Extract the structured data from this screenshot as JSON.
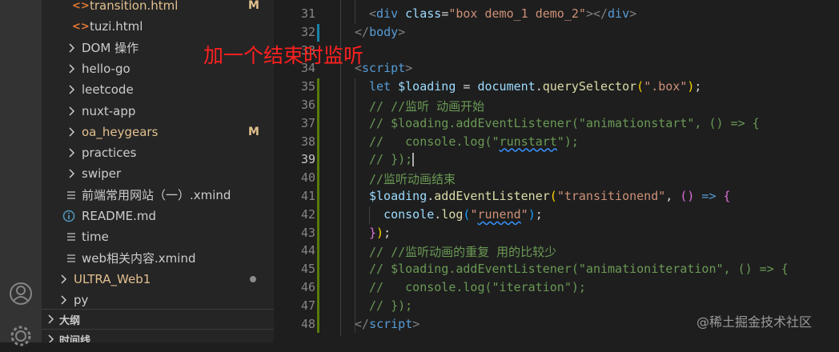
{
  "explorer": {
    "rows": [
      {
        "label": "transition.html",
        "type": "html",
        "badge": "M",
        "color": "#e2c08d"
      },
      {
        "label": "tuzi.html",
        "type": "html",
        "badge": "",
        "color": "#cccccc"
      },
      {
        "label": "DOM 操作",
        "type": "folder",
        "badge": "",
        "color": "#cccccc"
      },
      {
        "label": "hello-go",
        "type": "folder",
        "badge": "",
        "color": "#cccccc"
      },
      {
        "label": "leetcode",
        "type": "folder",
        "badge": "",
        "color": "#cccccc"
      },
      {
        "label": "nuxt-app",
        "type": "folder",
        "badge": "",
        "color": "#cccccc"
      },
      {
        "label": "oa_heygears",
        "type": "folder",
        "badge": "M",
        "color": "#e2c08d"
      },
      {
        "label": "practices",
        "type": "folder",
        "badge": "",
        "color": "#cccccc"
      },
      {
        "label": "swiper",
        "type": "folder",
        "badge": "",
        "color": "#cccccc"
      },
      {
        "label": "前端常用网站（一）.xmind",
        "type": "file",
        "badge": "",
        "color": "#cccccc"
      },
      {
        "label": "README.md",
        "type": "info",
        "badge": "",
        "color": "#cccccc"
      },
      {
        "label": "time",
        "type": "file",
        "badge": "",
        "color": "#cccccc"
      },
      {
        "label": "web相关内容.xmind",
        "type": "file",
        "badge": "",
        "color": "#cccccc"
      },
      {
        "label": "ULTRA_Web1",
        "type": "rootfolder",
        "badge": "dot",
        "color": "#e2c08d"
      },
      {
        "label": "py",
        "type": "rootfolder",
        "badge": "",
        "color": "#cccccc"
      }
    ],
    "sections": [
      {
        "label": "大纲"
      },
      {
        "label": "时间线"
      }
    ]
  },
  "editor": {
    "current_line": "39",
    "lines": [
      {
        "n": "31",
        "tokens": [
          {
            "t": "<",
            "c": "#808080"
          },
          {
            "t": "div",
            "c": "#569cd6"
          },
          {
            "t": " ",
            "c": "#d4d4d4"
          },
          {
            "t": "class",
            "c": "#9cdcfe"
          },
          {
            "t": "=",
            "c": "#d4d4d4"
          },
          {
            "t": "\"box demo_1 demo_2\"",
            "c": "#ce9178"
          },
          {
            "t": "></",
            "c": "#808080"
          },
          {
            "t": "div",
            "c": "#569cd6"
          },
          {
            "t": ">",
            "c": "#808080"
          }
        ]
      },
      {
        "n": "32",
        "tokens": [
          {
            "t": "</",
            "c": "#808080"
          },
          {
            "t": "body",
            "c": "#569cd6"
          },
          {
            "t": ">",
            "c": "#808080"
          }
        ]
      },
      {
        "n": "33",
        "tokens": []
      },
      {
        "n": "34",
        "tokens": [
          {
            "t": "<",
            "c": "#808080"
          },
          {
            "t": "script",
            "c": "#569cd6"
          },
          {
            "t": ">",
            "c": "#808080"
          }
        ]
      },
      {
        "n": "35",
        "tokens": [
          {
            "t": "let ",
            "c": "#569cd6"
          },
          {
            "t": "$loading",
            "c": "#9cdcfe"
          },
          {
            "t": " = ",
            "c": "#d4d4d4"
          },
          {
            "t": "document",
            "c": "#9cdcfe"
          },
          {
            "t": ".",
            "c": "#d4d4d4"
          },
          {
            "t": "querySelector",
            "c": "#dcdcaa"
          },
          {
            "t": "(",
            "c": "#ffd700"
          },
          {
            "t": "\".box\"",
            "c": "#ce9178"
          },
          {
            "t": ")",
            "c": "#ffd700"
          },
          {
            "t": ";",
            "c": "#d4d4d4"
          }
        ]
      },
      {
        "n": "36",
        "tokens": [
          {
            "t": "// //监听 动画开始",
            "c": "#6a9955"
          }
        ]
      },
      {
        "n": "37",
        "tokens": [
          {
            "t": "// $loading.addEventListener(\"animationstart\", () => {",
            "c": "#6a9955"
          }
        ]
      },
      {
        "n": "38",
        "tokens": [
          {
            "t": "//   console.log(\"",
            "c": "#6a9955"
          },
          {
            "t": "runstart",
            "c": "#6a9955",
            "sq": true
          },
          {
            "t": "\");",
            "c": "#6a9955"
          }
        ]
      },
      {
        "n": "39",
        "tokens": [
          {
            "t": "// });",
            "c": "#6a9955"
          }
        ]
      },
      {
        "n": "40",
        "tokens": [
          {
            "t": "//监听动画结束",
            "c": "#6a9955"
          }
        ]
      },
      {
        "n": "41",
        "tokens": [
          {
            "t": "$loading",
            "c": "#9cdcfe"
          },
          {
            "t": ".",
            "c": "#d4d4d4"
          },
          {
            "t": "addEventListener",
            "c": "#dcdcaa"
          },
          {
            "t": "(",
            "c": "#ffd700"
          },
          {
            "t": "\"transitionend\"",
            "c": "#ce9178"
          },
          {
            "t": ", ",
            "c": "#d4d4d4"
          },
          {
            "t": "()",
            "c": "#da70d6"
          },
          {
            "t": " => ",
            "c": "#569cd6"
          },
          {
            "t": "{",
            "c": "#da70d6"
          }
        ]
      },
      {
        "n": "42",
        "tokens": [
          {
            "t": "  ",
            "c": "#d4d4d4"
          },
          {
            "t": "console",
            "c": "#9cdcfe"
          },
          {
            "t": ".",
            "c": "#d4d4d4"
          },
          {
            "t": "log",
            "c": "#dcdcaa"
          },
          {
            "t": "(",
            "c": "#179fff"
          },
          {
            "t": "\"",
            "c": "#ce9178"
          },
          {
            "t": "runend",
            "c": "#ce9178",
            "sq": true
          },
          {
            "t": "\"",
            "c": "#ce9178"
          },
          {
            "t": ")",
            "c": "#179fff"
          },
          {
            "t": ";",
            "c": "#d4d4d4"
          }
        ]
      },
      {
        "n": "43",
        "tokens": [
          {
            "t": "}",
            "c": "#da70d6"
          },
          {
            "t": ")",
            "c": "#ffd700"
          },
          {
            "t": ";",
            "c": "#d4d4d4"
          }
        ]
      },
      {
        "n": "44",
        "tokens": [
          {
            "t": "// //监听动画的重复 用的比较少",
            "c": "#6a9955"
          }
        ]
      },
      {
        "n": "45",
        "tokens": [
          {
            "t": "// $loading.addEventListener(\"animationiteration\", () => {",
            "c": "#6a9955"
          }
        ]
      },
      {
        "n": "46",
        "tokens": [
          {
            "t": "//   console.log(\"iteration\");",
            "c": "#6a9955"
          }
        ]
      },
      {
        "n": "47",
        "tokens": [
          {
            "t": "// });",
            "c": "#6a9955"
          }
        ]
      },
      {
        "n": "48",
        "tokens": [
          {
            "t": "</",
            "c": "#808080"
          },
          {
            "t": "script",
            "c": "#569cd6"
          },
          {
            "t": ">",
            "c": "#808080"
          }
        ]
      }
    ]
  },
  "overlay_text": "加一个结束时监听",
  "watermark": "@稀土掘金技术社区",
  "colors": {
    "modified": "#e2c08d",
    "html_icon": "#e37933",
    "info_icon": "#519aba",
    "gutter_added": "#587c0c",
    "gutter_modified": "#1b81a8"
  }
}
